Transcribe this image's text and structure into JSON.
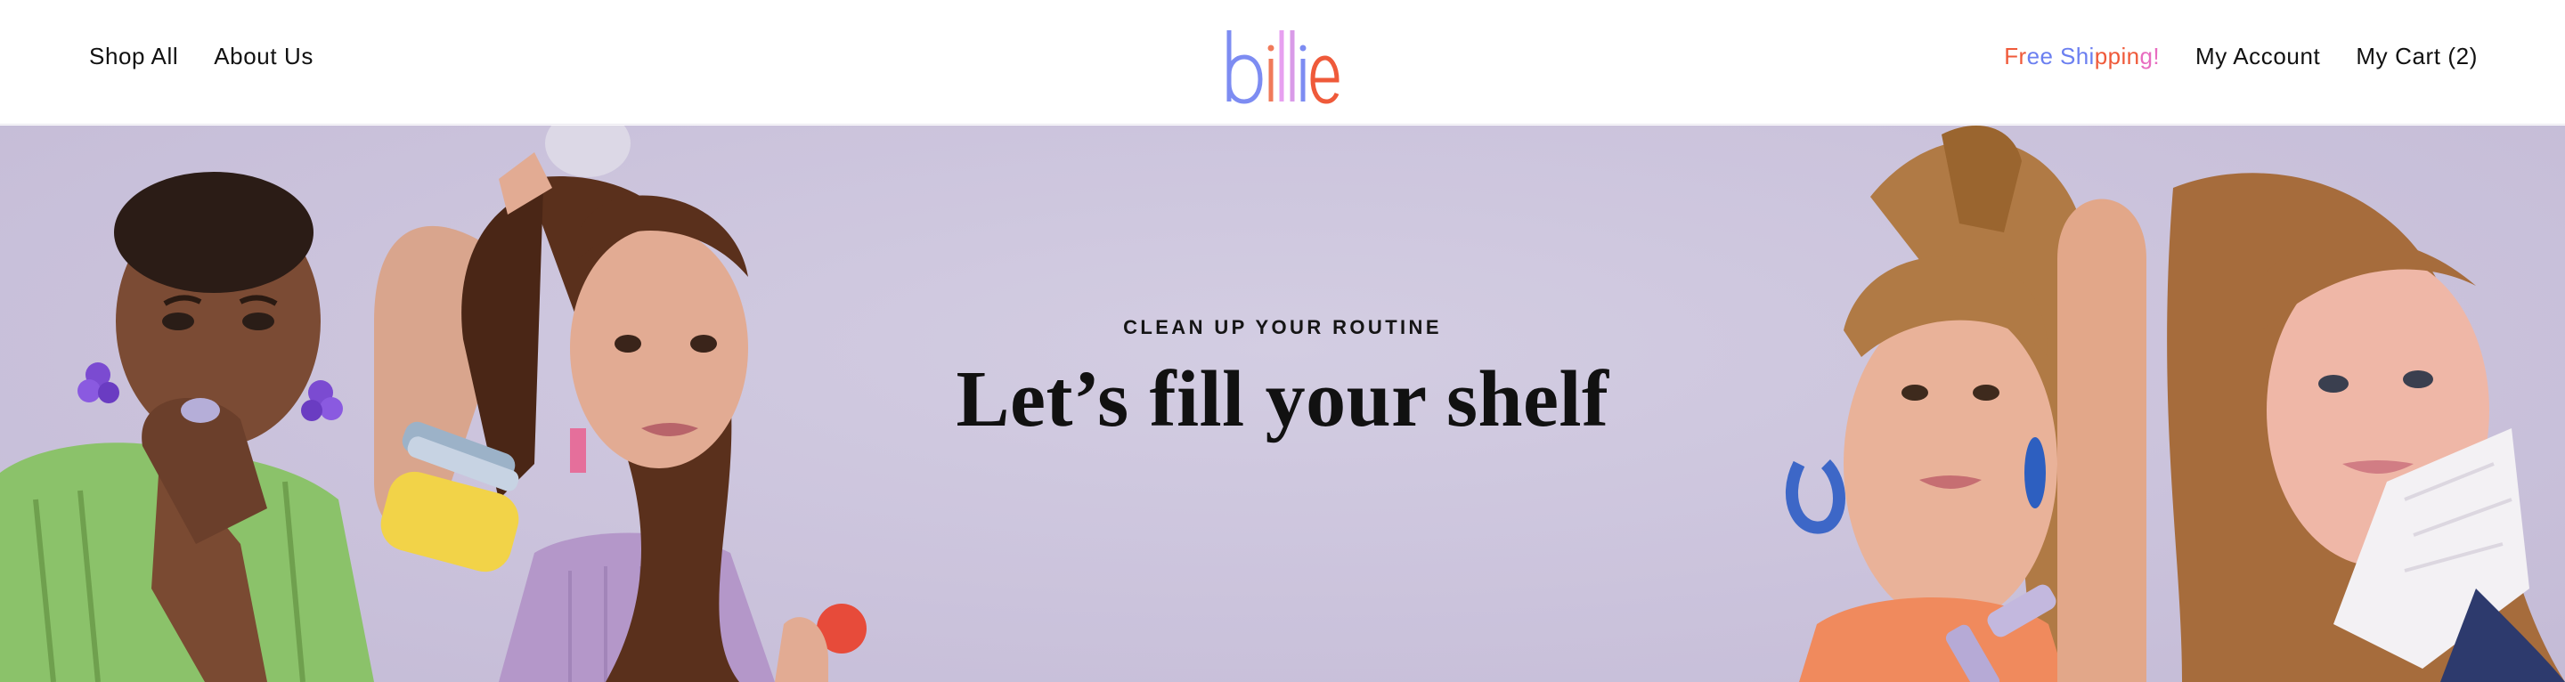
{
  "header": {
    "nav_left": [
      {
        "label": "Shop All"
      },
      {
        "label": "About Us"
      }
    ],
    "logo_text": "billie",
    "free_shipping": {
      "parts": [
        {
          "text": "Fr",
          "color": "#ef5a3a"
        },
        {
          "text": "ee Shi",
          "color": "#6b7ff0"
        },
        {
          "text": "ppin",
          "color": "#ef5a3a"
        },
        {
          "text": "g!",
          "color": "#e86cc0"
        }
      ]
    },
    "nav_right": [
      {
        "label": "My Account"
      },
      {
        "label": "My Cart (2)"
      }
    ]
  },
  "logo_colors": {
    "b": "#7d8cf2",
    "i1": "#f07a5a",
    "l1": "#e7a0f0",
    "l2": "#d99be8",
    "i2": "#7d8cf2",
    "e": "#ef5a3a"
  },
  "hero": {
    "eyebrow": "CLEAN UP YOUR ROUTINE",
    "title": "Let’s fill your shelf",
    "background": "#cbc3dc"
  }
}
